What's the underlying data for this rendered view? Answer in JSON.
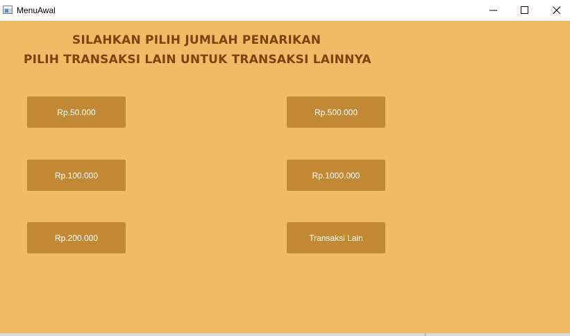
{
  "window": {
    "title": "MenuAwal"
  },
  "header": {
    "line1": "SILAHKAN PILIH JUMLAH PENARIKAN",
    "line2": "PILIH TRANSAKSI LAIN UNTUK TRANSAKSI LAINNYA"
  },
  "buttons": {
    "amount_50k": "Rp.50.000",
    "amount_100k": "Rp.100.000",
    "amount_200k": "Rp.200.000",
    "amount_500k": "Rp.500.000",
    "amount_1000k": "Rp.1000.000",
    "other": "Transaksi Lain"
  },
  "colors": {
    "background": "#f1ba65",
    "button": "#c28935",
    "heading": "#7a4410"
  },
  "icons": {
    "app": "app-window-icon",
    "minimize": "minimize-icon",
    "maximize": "maximize-icon",
    "close": "close-icon"
  }
}
